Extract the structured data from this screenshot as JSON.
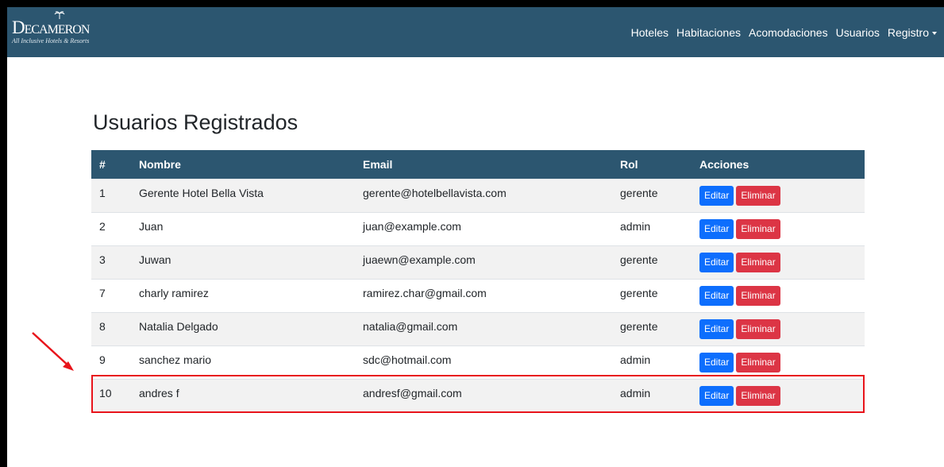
{
  "navbar": {
    "brand_name": "Decameron",
    "brand_tagline": "All Inclusive Hotels & Resorts",
    "links": [
      "Hoteles",
      "Habitaciones",
      "Acomodaciones",
      "Usuarios",
      "Registro"
    ]
  },
  "page_title": "Usuarios Registrados",
  "table": {
    "headers": [
      "#",
      "Nombre",
      "Email",
      "Rol",
      "Acciones"
    ],
    "rows": [
      {
        "id": "1",
        "nombre": "Gerente Hotel Bella Vista",
        "email": "gerente@hotelbellavista.com",
        "rol": "gerente"
      },
      {
        "id": "2",
        "nombre": "Juan",
        "email": "juan@example.com",
        "rol": "admin"
      },
      {
        "id": "3",
        "nombre": "Juwan",
        "email": "juaewn@example.com",
        "rol": "gerente"
      },
      {
        "id": "7",
        "nombre": "charly ramirez",
        "email": "ramirez.char@gmail.com",
        "rol": "gerente"
      },
      {
        "id": "8",
        "nombre": "Natalia Delgado",
        "email": "natalia@gmail.com",
        "rol": "gerente"
      },
      {
        "id": "9",
        "nombre": "sanchez mario",
        "email": "sdc@hotmail.com",
        "rol": "admin"
      },
      {
        "id": "10",
        "nombre": "andres f",
        "email": "andresf@gmail.com",
        "rol": "admin"
      }
    ],
    "edit_label": "Editar",
    "delete_label": "Eliminar"
  },
  "colors": {
    "navbar_bg": "#2c5670",
    "edit_button": "#0d6efd",
    "delete_button": "#dc3545",
    "highlight": "#e8141b"
  },
  "icons": {
    "dropdown": "chevron-down-icon",
    "annotation": "red-arrow-icon"
  }
}
